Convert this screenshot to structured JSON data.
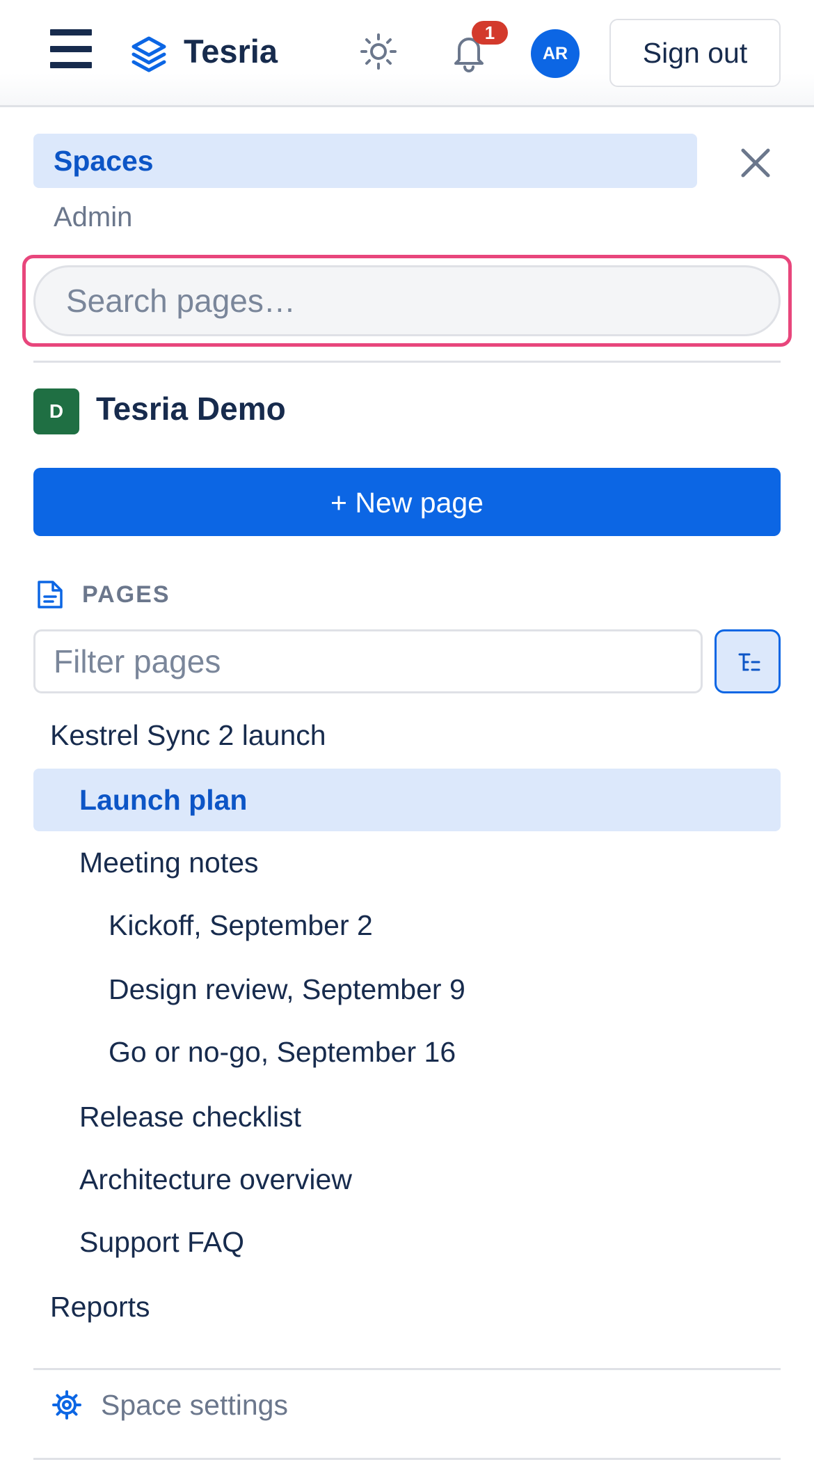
{
  "header": {
    "brand": "Tesria",
    "notification_count": "1",
    "avatar_initials": "AR",
    "signout_label": "Sign out",
    "icons": [
      "menu-icon",
      "layers-logo-icon",
      "sun-icon",
      "bell-icon"
    ]
  },
  "drawer": {
    "nav": {
      "spaces": "Spaces",
      "admin": "Admin"
    },
    "search": {
      "placeholder": "Search pages…",
      "value": ""
    },
    "space": {
      "initial": "D",
      "name": "Tesria Demo",
      "icon_color": "#1f6f43"
    },
    "new_page_label": "+ New page",
    "pages_heading": "PAGES",
    "filter": {
      "placeholder": "Filter pages",
      "value": ""
    },
    "tree": [
      {
        "label": "Kestrel Sync 2 launch",
        "depth": 0,
        "active": false
      },
      {
        "label": "Launch plan",
        "depth": 1,
        "active": true
      },
      {
        "label": "Meeting notes",
        "depth": 1,
        "active": false
      },
      {
        "label": "Kickoff, September 2",
        "depth": 2,
        "active": false
      },
      {
        "label": "Design review, September 9",
        "depth": 2,
        "active": false
      },
      {
        "label": "Go or no-go, September 16",
        "depth": 2,
        "active": false
      },
      {
        "label": "Release checklist",
        "depth": 1,
        "active": false
      },
      {
        "label": "Architecture overview",
        "depth": 1,
        "active": false
      },
      {
        "label": "Support FAQ",
        "depth": 1,
        "active": false
      },
      {
        "label": "Reports",
        "depth": 0,
        "active": false
      }
    ],
    "settings_label": "Space settings"
  },
  "colors": {
    "accent": "#0c66e4",
    "active_bg": "#dce8fb",
    "focus_ring": "#e8467c",
    "badge": "#d33a2c",
    "text": "#172b4d",
    "muted": "#6b778c"
  }
}
